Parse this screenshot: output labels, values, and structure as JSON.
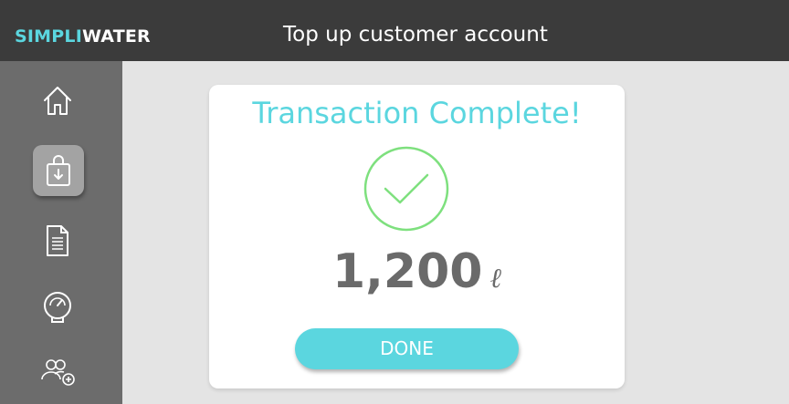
{
  "header": {
    "brand_part1": "SIMPLI",
    "brand_part2": "WATER",
    "title": "Top up customer account"
  },
  "sidebar": {
    "items": [
      {
        "icon": "home-icon",
        "active": false
      },
      {
        "icon": "shopping-bag-download-icon",
        "active": true
      },
      {
        "icon": "document-icon",
        "active": false
      },
      {
        "icon": "meter-gauge-icon",
        "active": false
      },
      {
        "icon": "add-users-icon",
        "active": false
      }
    ]
  },
  "dialog": {
    "title": "Transaction Complete!",
    "status_icon": "check-circle-icon",
    "amount": "1,200",
    "unit": "ℓ",
    "done_label": "DONE"
  },
  "colors": {
    "accent": "#5bd6df",
    "check": "#7ee07e",
    "topbar": "#3b3b3b",
    "sidebar": "#6c6c6c",
    "active_nav": "#a3a3a3",
    "background": "#e4e4e4"
  }
}
